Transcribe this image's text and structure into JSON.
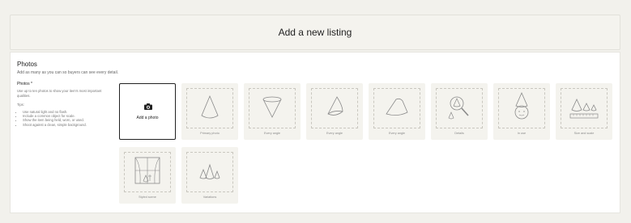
{
  "header": {
    "title": "Add a new listing"
  },
  "photos_section": {
    "title": "Photos",
    "subtitle": "Add as many as you can so buyers can see every detail.",
    "field_label": "Photos *",
    "help_text": "Use up to ten photos to show your item's most important qualities.",
    "tips_label": "Tips:",
    "tips": [
      "Use natural light and no flash.",
      "Include a common object for scale.",
      "Show the item being held, worn, or used.",
      "Shoot against a clean, simple background."
    ],
    "add_photo_label": "Add a photo",
    "slots": [
      {
        "caption": "Primary photo",
        "icon": "cone-icon"
      },
      {
        "caption": "Every angle",
        "icon": "cone-top-icon"
      },
      {
        "caption": "Every angle",
        "icon": "cone-tilted-icon"
      },
      {
        "caption": "Every angle",
        "icon": "cone-side-icon"
      },
      {
        "caption": "Details",
        "icon": "magnifier-cone-icon"
      },
      {
        "caption": "In use",
        "icon": "cone-hat-face-icon"
      },
      {
        "caption": "Size and scale",
        "icon": "cones-ruler-icon"
      },
      {
        "caption": "Styled scene",
        "icon": "window-scene-icon"
      },
      {
        "caption": "Variations",
        "icon": "cones-variations-icon"
      }
    ]
  }
}
